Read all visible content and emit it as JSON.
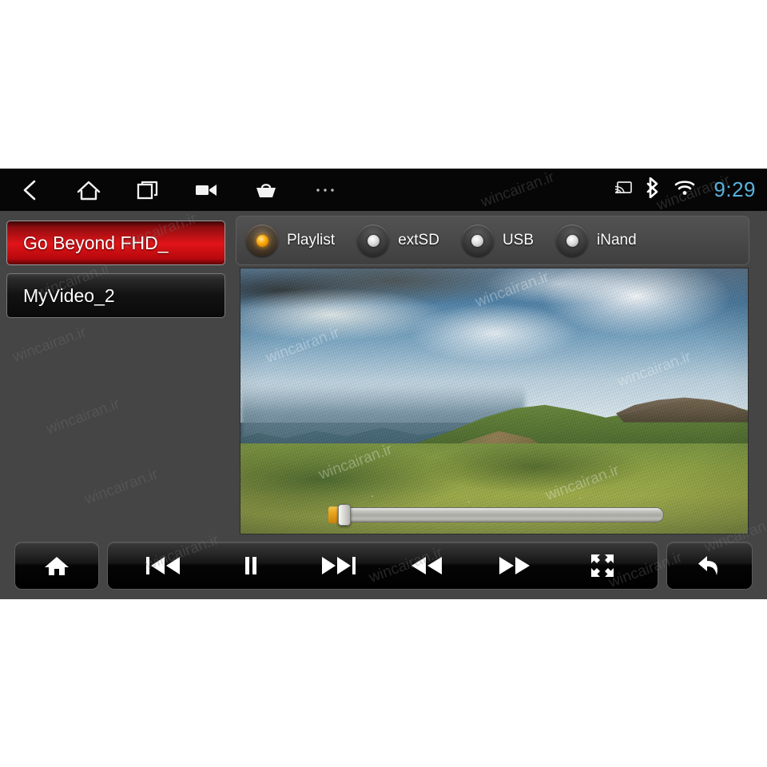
{
  "watermark": {
    "text": "wincairan.ir"
  },
  "statusbar": {
    "clock": "9:29",
    "nav_items": [
      {
        "name": "back-icon",
        "label": "Back"
      },
      {
        "name": "home-icon",
        "label": "Home"
      },
      {
        "name": "recents-icon",
        "label": "Recent apps"
      },
      {
        "name": "video-camera-icon",
        "label": "Camera"
      },
      {
        "name": "basket-icon",
        "label": "Apps"
      },
      {
        "name": "more-icon",
        "label": "More"
      }
    ],
    "indicators": [
      {
        "name": "cast-icon",
        "label": "Cast"
      },
      {
        "name": "bluetooth-icon",
        "label": "Bluetooth"
      },
      {
        "name": "wifi-icon",
        "label": "Wi-Fi"
      }
    ]
  },
  "playlist": {
    "items": [
      {
        "label": "Go Beyond FHD_",
        "selected": true
      },
      {
        "label": "MyVideo_2",
        "selected": false
      }
    ]
  },
  "sources": {
    "options": [
      {
        "label": "Playlist",
        "selected": true
      },
      {
        "label": "extSD",
        "selected": false
      },
      {
        "label": "USB",
        "selected": false
      },
      {
        "label": "iNand",
        "selected": false
      }
    ]
  },
  "player": {
    "seek_percent": 3,
    "seek_label": "Video progress"
  },
  "controls": {
    "home_label": "Home",
    "prev_label": "Previous track",
    "pause_label": "Pause",
    "next_label": "Next track",
    "rewind_label": "Rewind",
    "forward_label": "Fast forward",
    "fullscreen_label": "Full screen",
    "back_label": "Back"
  },
  "colors": {
    "accent_orange": "#ffaa08",
    "clock_blue": "#58b3de",
    "selected_red": "#e01418",
    "panel_gray": "#454545",
    "bar_black": "#060606"
  }
}
